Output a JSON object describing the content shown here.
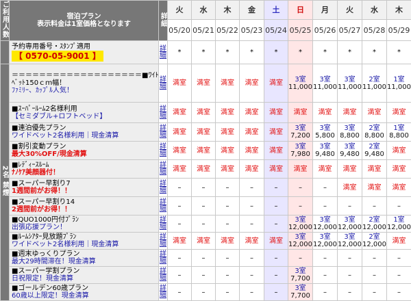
{
  "side_label_1": "ご利用人数",
  "side_label_2": "2名",
  "side_label_3": "禁煙",
  "header": {
    "title_line1": "宿泊プラン",
    "title_line2": "表示料金は1室価格となります",
    "detail": "詳細"
  },
  "days": [
    {
      "dow": "火",
      "date": "05/20",
      "kind": "weekday"
    },
    {
      "dow": "水",
      "date": "05/21",
      "kind": "weekday"
    },
    {
      "dow": "木",
      "date": "05/22",
      "kind": "weekday"
    },
    {
      "dow": "金",
      "date": "05/23",
      "kind": "weekday"
    },
    {
      "dow": "土",
      "date": "05/24",
      "kind": "sat"
    },
    {
      "dow": "日",
      "date": "05/25",
      "kind": "sun"
    },
    {
      "dow": "月",
      "date": "05/26",
      "kind": "weekday"
    },
    {
      "dow": "火",
      "date": "05/27",
      "kind": "weekday"
    },
    {
      "dow": "水",
      "date": "05/28",
      "kind": "weekday"
    },
    {
      "dow": "木",
      "date": "05/29",
      "kind": "weekday"
    }
  ],
  "detail_label": "詳細",
  "plans": [
    {
      "lines": [
        "予約専用番号・ｽﾀﾝﾌﾟ適用",
        "【 0570-05-9001 】"
      ],
      "styles": [
        "",
        "phone"
      ],
      "cells": [
        "*",
        "*",
        "*",
        "*",
        "*",
        "*",
        "*",
        "*",
        "*",
        "*"
      ]
    },
    {
      "lines": [
        "＝＝＝＝＝＝＝＝＝＝＝＝＝＝＝＝＝＝＝■ﾜｲﾄﾞ",
        "ﾍﾞｯﾄ150ｃｍ幅！",
        "ﾌｧﾐﾘｰ、ｶｯﾌﾟﾙ人気！"
      ],
      "styles": [
        "",
        "",
        "blue"
      ],
      "cells": [
        "満室",
        "満室",
        "満室",
        "満室",
        "満室",
        "3室\n11,000",
        "3室\n11,000",
        "3室\n11,000",
        "2室\n11,000",
        "1室\n11,000"
      ]
    },
    {
      "lines": [
        "■ｽｰﾊﾟｰﾙｰﾑ2名様利用",
        "【セミダブル+ロフトベッド】"
      ],
      "styles": [
        "",
        "blue"
      ],
      "cells": [
        "満室",
        "満室",
        "満室",
        "満室",
        "満室",
        "満室",
        "満室",
        "満室",
        "満室",
        "満室"
      ]
    },
    {
      "lines": [
        "■連泊優先プラン",
        "ワイドベット2名様利用｜現金清算"
      ],
      "styles": [
        "",
        "blue"
      ],
      "cells": [
        "満室",
        "満室",
        "満室",
        "満室",
        "満室",
        "3室\n7,200",
        "3室\n5,800",
        "3室\n8,800",
        "2室\n8,800",
        "1室\n8,800"
      ]
    },
    {
      "lines": [
        "■割引変動プラン",
        "最大30%OFF/現金清算"
      ],
      "styles": [
        "",
        "red"
      ],
      "cells": [
        "満室",
        "満室",
        "満室",
        "満室",
        "満室",
        "3室\n7,980",
        "3室\n9,480",
        "3室\n9,480",
        "2室\n9,480",
        "満室"
      ]
    },
    {
      "lines": [
        "■ﾚﾃﾞｨｰｽﾙｰﾑ",
        "ﾅﾉｹｱ美顔器付！"
      ],
      "styles": [
        "",
        "red"
      ],
      "cells": [
        "満室",
        "満室",
        "満室",
        "満室",
        "満室",
        "満室",
        "満室",
        "満室",
        "満室",
        "満室"
      ]
    },
    {
      "lines": [
        "■スーパー早割り7",
        "1週間前がお得！！"
      ],
      "styles": [
        "",
        "red"
      ],
      "cells": [
        "–",
        "–",
        "–",
        "–",
        "–",
        "–",
        "–",
        "満室",
        "満室",
        "満室"
      ]
    },
    {
      "lines": [
        "■スーパー早割り14",
        "2週間前がお得！！"
      ],
      "styles": [
        "",
        "red"
      ],
      "cells": [
        "–",
        "–",
        "–",
        "–",
        "–",
        "–",
        "–",
        "–",
        "–",
        "–"
      ]
    },
    {
      "lines": [
        "■QUO1000円付ﾌﾟﾗﾝ",
        "出張応援プラン！"
      ],
      "styles": [
        "",
        "blue"
      ],
      "cells": [
        "–",
        "–",
        "–",
        "–",
        "–",
        "3室\n12,000",
        "3室\n12,000",
        "3室\n12,000",
        "2室\n12,000",
        "1室\n12,000"
      ]
    },
    {
      "lines": [
        "■ﾙｰﾑｼｱﾀｰ見放題ﾌﾟﾗﾝ",
        "ワイドベット2名様利用｜現金清算"
      ],
      "styles": [
        "",
        "blue"
      ],
      "cells": [
        "満室",
        "満室",
        "満室",
        "満室",
        "満室",
        "3室\n12,000",
        "3室\n12,000",
        "3室\n12,000",
        "2室\n12,000",
        "満室"
      ]
    },
    {
      "lines": [
        "■週末ゆっくりプラン",
        "最大29時間滞在！現金清算"
      ],
      "styles": [
        "",
        "blue"
      ],
      "cells": [
        "–",
        "–",
        "–",
        "–",
        "–",
        "–",
        "–",
        "–",
        "–",
        "–"
      ]
    },
    {
      "lines": [
        "■スーパー学割プラン",
        "日祝限定！現金清算"
      ],
      "styles": [
        "",
        "blue"
      ],
      "cells": [
        "–",
        "–",
        "–",
        "–",
        "–",
        "3室\n7,700",
        "–",
        "–",
        "–",
        "–"
      ]
    },
    {
      "lines": [
        "■ゴールデン60歳プラン",
        "60歳以上限定！現金清算"
      ],
      "styles": [
        "",
        "blue"
      ],
      "cells": [
        "–",
        "–",
        "–",
        "–",
        "–",
        "3室\n7,700",
        "–",
        "–",
        "–",
        "–"
      ]
    }
  ]
}
